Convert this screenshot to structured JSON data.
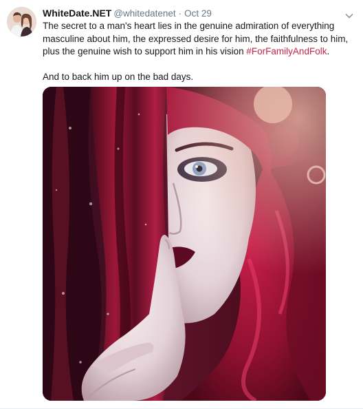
{
  "tweet": {
    "author": {
      "display_name": "WhiteDate.NET",
      "handle": "@whitedatenet",
      "avatar_icon": "profile-photo-couple"
    },
    "separator": "·",
    "timestamp": "Oct 29",
    "text_before_hashtag": "The secret to a man's heart lies in the genuine admiration of everything masculine about him, the expressed desire for him, the faithfulness to him, plus the genuine wish to support him in his vision ",
    "hashtag": "#ForFamilyAndFolk",
    "text_after_hashtag": ".",
    "second_paragraph": "And to back him up on the bad days.",
    "colors": {
      "hashtag": "#c5254d",
      "handle": "#657786",
      "text": "#14171a"
    },
    "menu_icon": "chevron-down-icon",
    "media_icon": "photo-woman-red-hair"
  }
}
